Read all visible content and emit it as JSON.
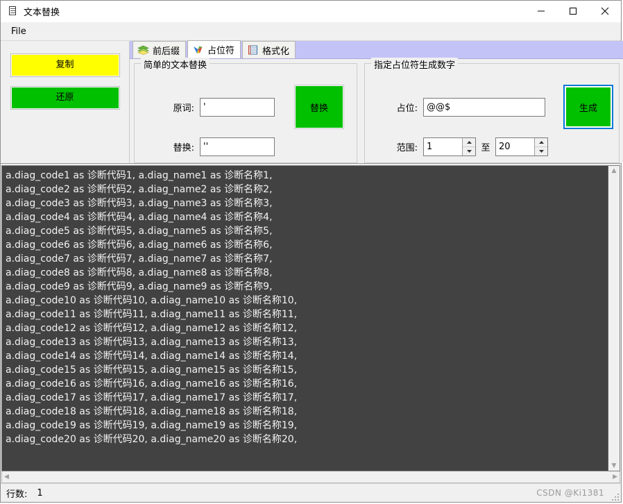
{
  "window": {
    "title": "文本替换",
    "icon": "document-icon",
    "minimize_label": "—",
    "maximize_label": "□",
    "close_label": "✕"
  },
  "menubar": {
    "items": [
      {
        "label": "File",
        "name": "menu-file"
      }
    ]
  },
  "sidebar": {
    "buttons": [
      {
        "label": "复制",
        "name": "copy-button",
        "color": "#ffff00"
      },
      {
        "label": "还原",
        "name": "restore-button",
        "color": "#00c000"
      }
    ]
  },
  "tabs": [
    {
      "label": "前后缀",
      "icon": "layers-icon",
      "active": false
    },
    {
      "label": "占位符",
      "icon": "colored-flag-icon",
      "active": true
    },
    {
      "label": "格式化",
      "icon": "table-grid-icon",
      "active": false
    }
  ],
  "replace_group": {
    "title": "简单的文本替换",
    "original_label": "原词:",
    "original_value": "'",
    "replace_label": "替换:",
    "replace_value": "''",
    "button_label": "替换"
  },
  "generate_group": {
    "title": "指定占位符生成数字",
    "placeholder_label": "占位:",
    "placeholder_value": "@@$",
    "range_label": "范围:",
    "range_from": "1",
    "range_to_label": "至",
    "range_to": "20",
    "button_label": "生成",
    "button_focus_color": "#0078d7"
  },
  "editor": {
    "background": "#424242",
    "foreground": "#f2f2f2",
    "lines": [
      "a.diag_code1 as 诊断代码1, a.diag_name1 as 诊断名称1,",
      "a.diag_code2 as 诊断代码2, a.diag_name2 as 诊断名称2,",
      "a.diag_code3 as 诊断代码3, a.diag_name3 as 诊断名称3,",
      "a.diag_code4 as 诊断代码4, a.diag_name4 as 诊断名称4,",
      "a.diag_code5 as 诊断代码5, a.diag_name5 as 诊断名称5,",
      "a.diag_code6 as 诊断代码6, a.diag_name6 as 诊断名称6,",
      "a.diag_code7 as 诊断代码7, a.diag_name7 as 诊断名称7,",
      "a.diag_code8 as 诊断代码8, a.diag_name8 as 诊断名称8,",
      "a.diag_code9 as 诊断代码9, a.diag_name9 as 诊断名称9,",
      "a.diag_code10 as 诊断代码10, a.diag_name10 as 诊断名称10,",
      "a.diag_code11 as 诊断代码11, a.diag_name11 as 诊断名称11,",
      "a.diag_code12 as 诊断代码12, a.diag_name12 as 诊断名称12,",
      "a.diag_code13 as 诊断代码13, a.diag_name13 as 诊断名称13,",
      "a.diag_code14 as 诊断代码14, a.diag_name14 as 诊断名称14,",
      "a.diag_code15 as 诊断代码15, a.diag_name15 as 诊断名称15,",
      "a.diag_code16 as 诊断代码16, a.diag_name16 as 诊断名称16,",
      "a.diag_code17 as 诊断代码17, a.diag_name17 as 诊断名称17,",
      "a.diag_code18 as 诊断代码18, a.diag_name18 as 诊断名称18,",
      "a.diag_code19 as 诊断代码19, a.diag_name19 as 诊断名称19,",
      "a.diag_code20 as 诊断代码20, a.diag_name20 as 诊断名称20,"
    ]
  },
  "statusbar": {
    "line_count_label": "行数:",
    "line_count_value": "1",
    "watermark": "CSDN @Ki1381"
  }
}
